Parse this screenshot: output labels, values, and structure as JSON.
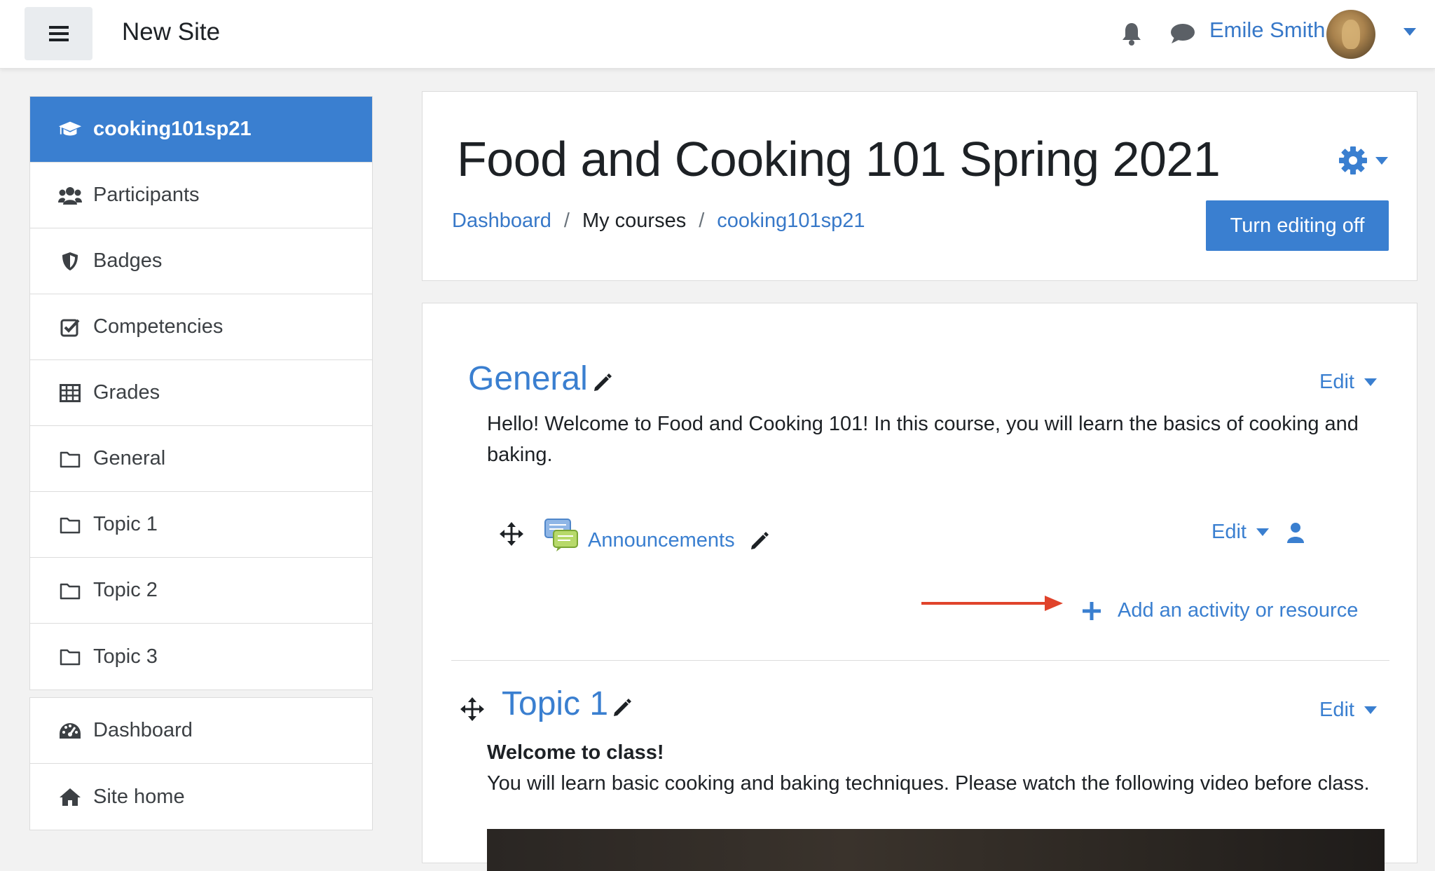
{
  "navbar": {
    "site_name": "New Site",
    "user_name": "Emile Smith",
    "icons": [
      "hamburger-menu-icon",
      "bell-icon",
      "chat-icon",
      "avatar",
      "caret-down-icon"
    ]
  },
  "drawer": {
    "course_items": [
      {
        "label": "cooking101sp21",
        "icon": "graduation-cap-icon",
        "active": true
      },
      {
        "label": "Participants",
        "icon": "users-icon"
      },
      {
        "label": "Badges",
        "icon": "shield-icon"
      },
      {
        "label": "Competencies",
        "icon": "check-square-icon"
      },
      {
        "label": "Grades",
        "icon": "table-icon"
      },
      {
        "label": "General",
        "icon": "folder-icon"
      },
      {
        "label": "Topic 1",
        "icon": "folder-icon"
      },
      {
        "label": "Topic 2",
        "icon": "folder-icon"
      },
      {
        "label": "Topic 3",
        "icon": "folder-icon"
      }
    ],
    "site_items": [
      {
        "label": "Dashboard",
        "icon": "dashboard-icon"
      },
      {
        "label": "Site home",
        "icon": "home-icon"
      }
    ]
  },
  "header": {
    "course_title": "Food and Cooking 101 Spring 2021",
    "breadcrumb": {
      "dashboard": "Dashboard",
      "separator": "/",
      "my_courses": "My courses",
      "course": "cooking101sp21"
    },
    "edit_toggle_label": "Turn editing off"
  },
  "content": {
    "general": {
      "title": "General",
      "edit_label": "Edit",
      "summary": "Hello! Welcome to Food and Cooking 101! In this course, you will learn the basics of cooking and baking.",
      "activity": {
        "name": "Announcements",
        "edit_label": "Edit",
        "icon": "forum-icon"
      },
      "add_activity_label": "Add an activity or resource"
    },
    "topic1": {
      "title": "Topic 1",
      "edit_label": "Edit",
      "summary_heading": "Welcome to class!",
      "summary_text": "You will learn basic cooking and baking techniques. Please watch the following video before class."
    },
    "accent_color": "#3a7fd0",
    "annotation_arrow_color": "#e0432b"
  }
}
